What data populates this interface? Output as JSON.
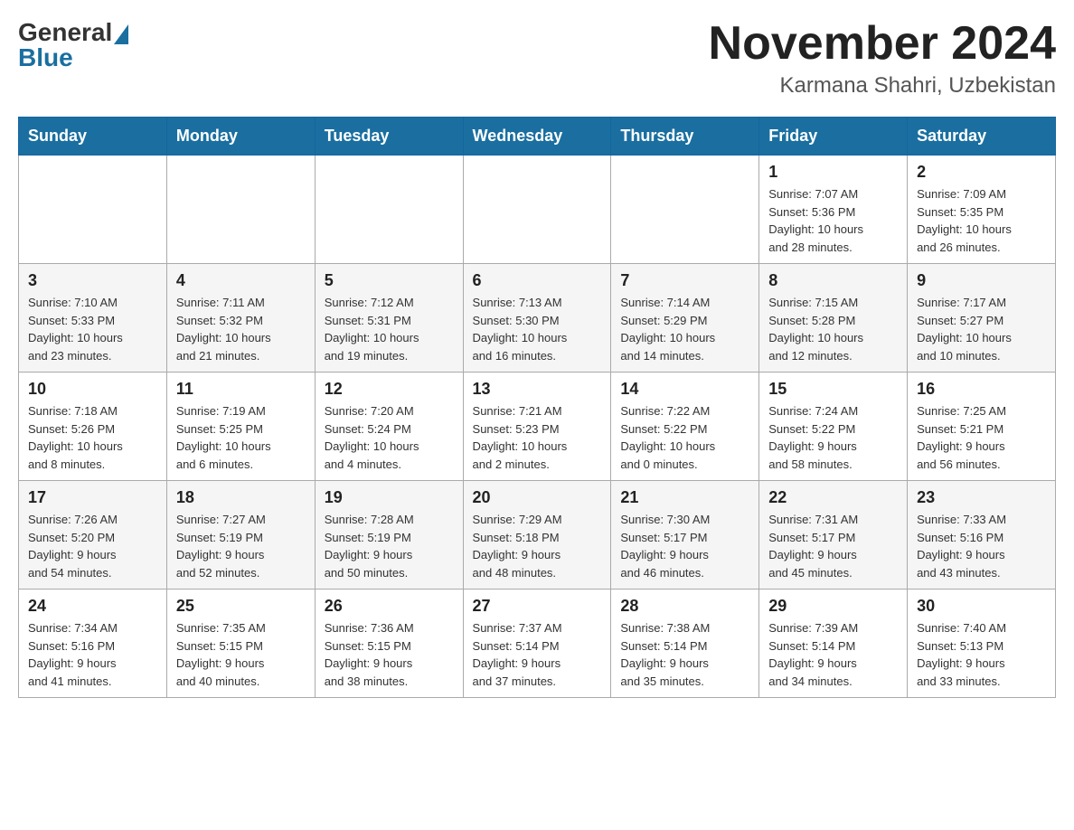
{
  "header": {
    "logo_general": "General",
    "logo_blue": "Blue",
    "month_title": "November 2024",
    "location": "Karmana Shahri, Uzbekistan"
  },
  "weekdays": [
    "Sunday",
    "Monday",
    "Tuesday",
    "Wednesday",
    "Thursday",
    "Friday",
    "Saturday"
  ],
  "weeks": [
    [
      {
        "day": "",
        "info": ""
      },
      {
        "day": "",
        "info": ""
      },
      {
        "day": "",
        "info": ""
      },
      {
        "day": "",
        "info": ""
      },
      {
        "day": "",
        "info": ""
      },
      {
        "day": "1",
        "info": "Sunrise: 7:07 AM\nSunset: 5:36 PM\nDaylight: 10 hours\nand 28 minutes."
      },
      {
        "day": "2",
        "info": "Sunrise: 7:09 AM\nSunset: 5:35 PM\nDaylight: 10 hours\nand 26 minutes."
      }
    ],
    [
      {
        "day": "3",
        "info": "Sunrise: 7:10 AM\nSunset: 5:33 PM\nDaylight: 10 hours\nand 23 minutes."
      },
      {
        "day": "4",
        "info": "Sunrise: 7:11 AM\nSunset: 5:32 PM\nDaylight: 10 hours\nand 21 minutes."
      },
      {
        "day": "5",
        "info": "Sunrise: 7:12 AM\nSunset: 5:31 PM\nDaylight: 10 hours\nand 19 minutes."
      },
      {
        "day": "6",
        "info": "Sunrise: 7:13 AM\nSunset: 5:30 PM\nDaylight: 10 hours\nand 16 minutes."
      },
      {
        "day": "7",
        "info": "Sunrise: 7:14 AM\nSunset: 5:29 PM\nDaylight: 10 hours\nand 14 minutes."
      },
      {
        "day": "8",
        "info": "Sunrise: 7:15 AM\nSunset: 5:28 PM\nDaylight: 10 hours\nand 12 minutes."
      },
      {
        "day": "9",
        "info": "Sunrise: 7:17 AM\nSunset: 5:27 PM\nDaylight: 10 hours\nand 10 minutes."
      }
    ],
    [
      {
        "day": "10",
        "info": "Sunrise: 7:18 AM\nSunset: 5:26 PM\nDaylight: 10 hours\nand 8 minutes."
      },
      {
        "day": "11",
        "info": "Sunrise: 7:19 AM\nSunset: 5:25 PM\nDaylight: 10 hours\nand 6 minutes."
      },
      {
        "day": "12",
        "info": "Sunrise: 7:20 AM\nSunset: 5:24 PM\nDaylight: 10 hours\nand 4 minutes."
      },
      {
        "day": "13",
        "info": "Sunrise: 7:21 AM\nSunset: 5:23 PM\nDaylight: 10 hours\nand 2 minutes."
      },
      {
        "day": "14",
        "info": "Sunrise: 7:22 AM\nSunset: 5:22 PM\nDaylight: 10 hours\nand 0 minutes."
      },
      {
        "day": "15",
        "info": "Sunrise: 7:24 AM\nSunset: 5:22 PM\nDaylight: 9 hours\nand 58 minutes."
      },
      {
        "day": "16",
        "info": "Sunrise: 7:25 AM\nSunset: 5:21 PM\nDaylight: 9 hours\nand 56 minutes."
      }
    ],
    [
      {
        "day": "17",
        "info": "Sunrise: 7:26 AM\nSunset: 5:20 PM\nDaylight: 9 hours\nand 54 minutes."
      },
      {
        "day": "18",
        "info": "Sunrise: 7:27 AM\nSunset: 5:19 PM\nDaylight: 9 hours\nand 52 minutes."
      },
      {
        "day": "19",
        "info": "Sunrise: 7:28 AM\nSunset: 5:19 PM\nDaylight: 9 hours\nand 50 minutes."
      },
      {
        "day": "20",
        "info": "Sunrise: 7:29 AM\nSunset: 5:18 PM\nDaylight: 9 hours\nand 48 minutes."
      },
      {
        "day": "21",
        "info": "Sunrise: 7:30 AM\nSunset: 5:17 PM\nDaylight: 9 hours\nand 46 minutes."
      },
      {
        "day": "22",
        "info": "Sunrise: 7:31 AM\nSunset: 5:17 PM\nDaylight: 9 hours\nand 45 minutes."
      },
      {
        "day": "23",
        "info": "Sunrise: 7:33 AM\nSunset: 5:16 PM\nDaylight: 9 hours\nand 43 minutes."
      }
    ],
    [
      {
        "day": "24",
        "info": "Sunrise: 7:34 AM\nSunset: 5:16 PM\nDaylight: 9 hours\nand 41 minutes."
      },
      {
        "day": "25",
        "info": "Sunrise: 7:35 AM\nSunset: 5:15 PM\nDaylight: 9 hours\nand 40 minutes."
      },
      {
        "day": "26",
        "info": "Sunrise: 7:36 AM\nSunset: 5:15 PM\nDaylight: 9 hours\nand 38 minutes."
      },
      {
        "day": "27",
        "info": "Sunrise: 7:37 AM\nSunset: 5:14 PM\nDaylight: 9 hours\nand 37 minutes."
      },
      {
        "day": "28",
        "info": "Sunrise: 7:38 AM\nSunset: 5:14 PM\nDaylight: 9 hours\nand 35 minutes."
      },
      {
        "day": "29",
        "info": "Sunrise: 7:39 AM\nSunset: 5:14 PM\nDaylight: 9 hours\nand 34 minutes."
      },
      {
        "day": "30",
        "info": "Sunrise: 7:40 AM\nSunset: 5:13 PM\nDaylight: 9 hours\nand 33 minutes."
      }
    ]
  ]
}
